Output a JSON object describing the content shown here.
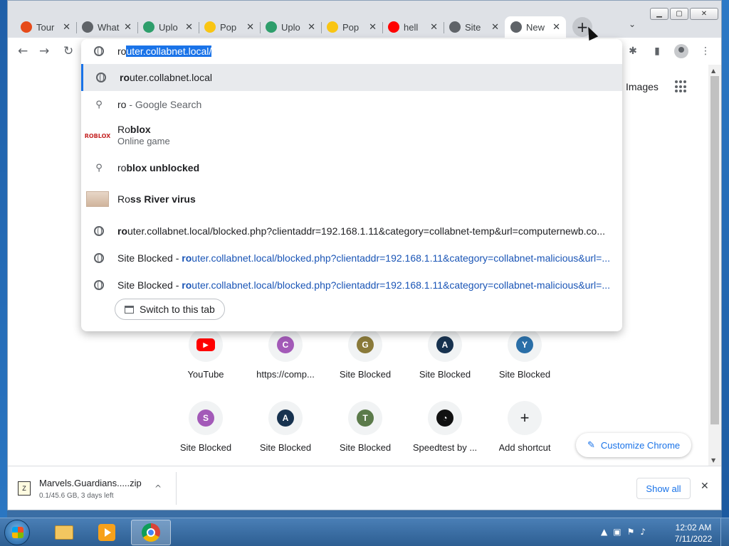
{
  "browser": {
    "tabs": [
      {
        "title": "Tour",
        "color": "#e64a19",
        "glyph": ""
      },
      {
        "title": "What",
        "color": "#5f6368",
        "glyph": ""
      },
      {
        "title": "Uplo",
        "color": "#2e9e6b",
        "glyph": ""
      },
      {
        "title": "Pop",
        "color": "#f9c513",
        "glyph": ""
      },
      {
        "title": "Uplo",
        "color": "#2e9e6b",
        "glyph": ""
      },
      {
        "title": "Pop",
        "color": "#f9c513",
        "glyph": ""
      },
      {
        "title": "hell",
        "color": "#ff0000",
        "glyph": ""
      },
      {
        "title": "Site",
        "color": "#5f6368",
        "glyph": ""
      },
      {
        "title": "New",
        "color": "#5f6368",
        "glyph": ""
      }
    ],
    "tab_close_glyph": "✕",
    "new_tab_glyph": "+",
    "tab_search_glyph": "⌄",
    "nav": {
      "back": "←",
      "forward": "→",
      "reload": "↻"
    },
    "win": {
      "minimize": "▁",
      "maximize": "▢",
      "close": "✕"
    }
  },
  "omnibox": {
    "typed": "ro",
    "completion": "uter.collabnet.local/",
    "suggestions": [
      {
        "type": "url",
        "bold": "ro",
        "rest": "uter.collabnet.local"
      },
      {
        "type": "search",
        "text": "ro",
        "suffix": " - Google Search"
      },
      {
        "type": "entity",
        "prefix": "Ro",
        "bold": "blox",
        "subtitle": "Online game",
        "thumb_label": "ROBLOX"
      },
      {
        "type": "search",
        "prefix": "ro",
        "bold": "blox unblocked"
      },
      {
        "type": "entity",
        "prefix": "Ro",
        "bold": "ss River virus"
      },
      {
        "type": "url",
        "bold": "ro",
        "rest": "uter.collabnet.local/blocked.php?clientaddr=192.168.1.11&category=collabnet-temp&url=computernewb.co..."
      },
      {
        "type": "history",
        "title": "Site Blocked",
        "sep": " - ",
        "bold": "ro",
        "rest": "uter.collabnet.local/blocked.php?clientaddr=192.168.1.11&category=collabnet-malicious&url=..."
      },
      {
        "type": "history",
        "title": "Site Blocked",
        "sep": " - ",
        "bold": "ro",
        "rest": "uter.collabnet.local/blocked.php?clientaddr=192.168.1.11&category=collabnet-malicious&url=..."
      }
    ],
    "switch_tab_label": "Switch to this tab"
  },
  "ntp": {
    "images_link": "Images",
    "shortcuts": [
      {
        "label": "YouTube",
        "letter": "",
        "color": "#ff0000"
      },
      {
        "label": "https://comp...",
        "letter": "C",
        "color": "#a35ab8"
      },
      {
        "label": "Site Blocked",
        "letter": "G",
        "color": "#8a7a3a"
      },
      {
        "label": "Site Blocked",
        "letter": "A",
        "color": "#17324f"
      },
      {
        "label": "Site Blocked",
        "letter": "Y",
        "color": "#2a6fa8"
      },
      {
        "label": "Site Blocked",
        "letter": "S",
        "color": "#a35ab8"
      },
      {
        "label": "Site Blocked",
        "letter": "A",
        "color": "#17324f"
      },
      {
        "label": "Site Blocked",
        "letter": "T",
        "color": "#5b7a4a"
      },
      {
        "label": "Speedtest by ...",
        "letter": "",
        "color": "#111111"
      },
      {
        "label": "Add shortcut",
        "letter": "+",
        "color": ""
      }
    ],
    "customize_label": "Customize Chrome",
    "customize_glyph": "✎"
  },
  "download": {
    "filename": "Marvels.Guardians.....zip",
    "status": "0.1/45.6 GB, 3 days left",
    "chevron": "^",
    "show_all": "Show all",
    "close": "✕"
  },
  "taskbar": {
    "time": "12:02 AM",
    "date": "7/11/2022",
    "tray": [
      "▲",
      "▣",
      "⚑",
      "♪"
    ]
  }
}
